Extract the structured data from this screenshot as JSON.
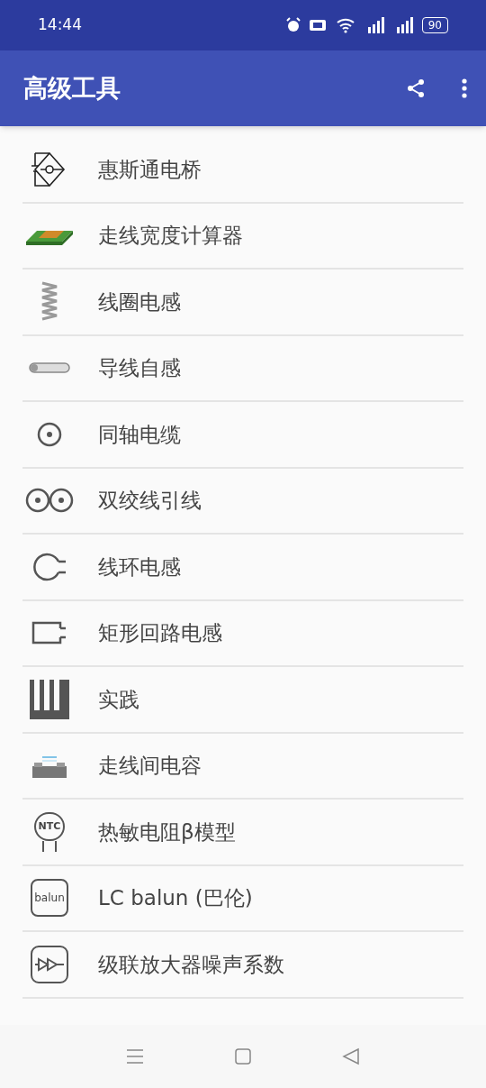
{
  "status_bar": {
    "time": "14:44",
    "battery": "90"
  },
  "app_bar": {
    "title": "高级工具"
  },
  "items": [
    {
      "kind": "bridge",
      "label": "惠斯通电桥"
    },
    {
      "kind": "pcb",
      "label": "走线宽度计算器"
    },
    {
      "kind": "coil",
      "label": "线圈电感"
    },
    {
      "kind": "wire",
      "label": "导线自感"
    },
    {
      "kind": "coax",
      "label": "同轴电缆"
    },
    {
      "kind": "twin",
      "label": "双绞线引线"
    },
    {
      "kind": "loop",
      "label": "线环电感"
    },
    {
      "kind": "rect",
      "label": "矩形回路电感"
    },
    {
      "kind": "heatsink",
      "label": "实践"
    },
    {
      "kind": "trace_cap",
      "label": "走线间电容"
    },
    {
      "kind": "ntc",
      "label": "热敏电阻β模型",
      "icon_text": "NTC"
    },
    {
      "kind": "balun",
      "label": "LC balun (巴伦)",
      "icon_text": "balun"
    },
    {
      "kind": "amp",
      "label": "级联放大器噪声系数"
    }
  ]
}
